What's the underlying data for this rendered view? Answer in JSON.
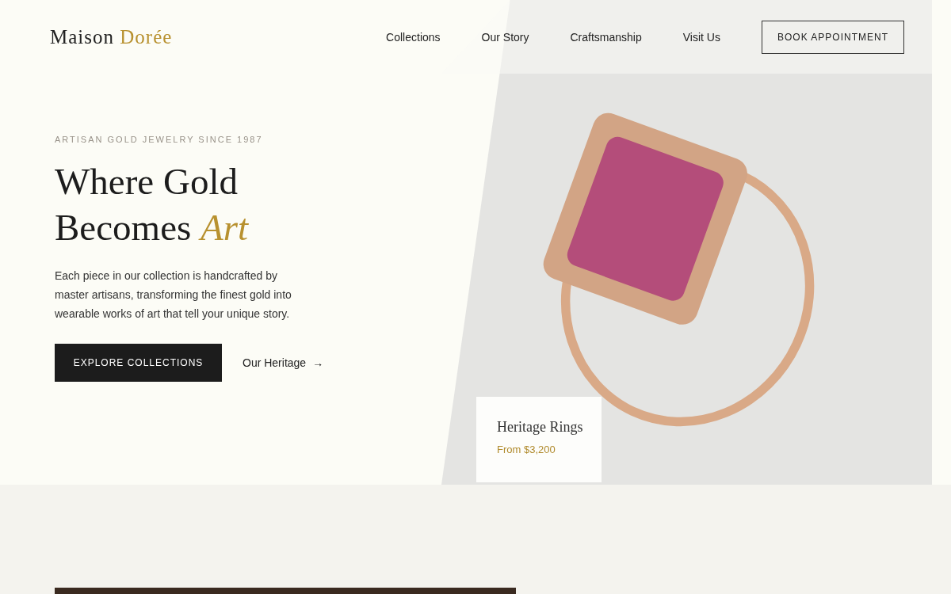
{
  "header": {
    "logo": {
      "primary": "Maison",
      "accent": "Dorée"
    },
    "nav": [
      {
        "label": "Collections"
      },
      {
        "label": "Our Story"
      },
      {
        "label": "Craftsmanship"
      },
      {
        "label": "Visit Us"
      }
    ],
    "cta": "BOOK APPOINTMENT"
  },
  "hero": {
    "eyebrow": "ARTISAN GOLD JEWELRY SINCE 1987",
    "title_line_1": "Where Gold",
    "title_line_2": "Becomes *Art*",
    "description": "Each piece in our collection is handcrafted by master artisans, transforming the finest gold into wearable works of art that tell your unique story.",
    "primary_button": "EXPLORE COLLECTIONS",
    "secondary_link": "Our Heritage",
    "secondary_arrow": "→",
    "feature_card": {
      "title": "Heritage Rings",
      "price": "From $3,200"
    }
  }
}
